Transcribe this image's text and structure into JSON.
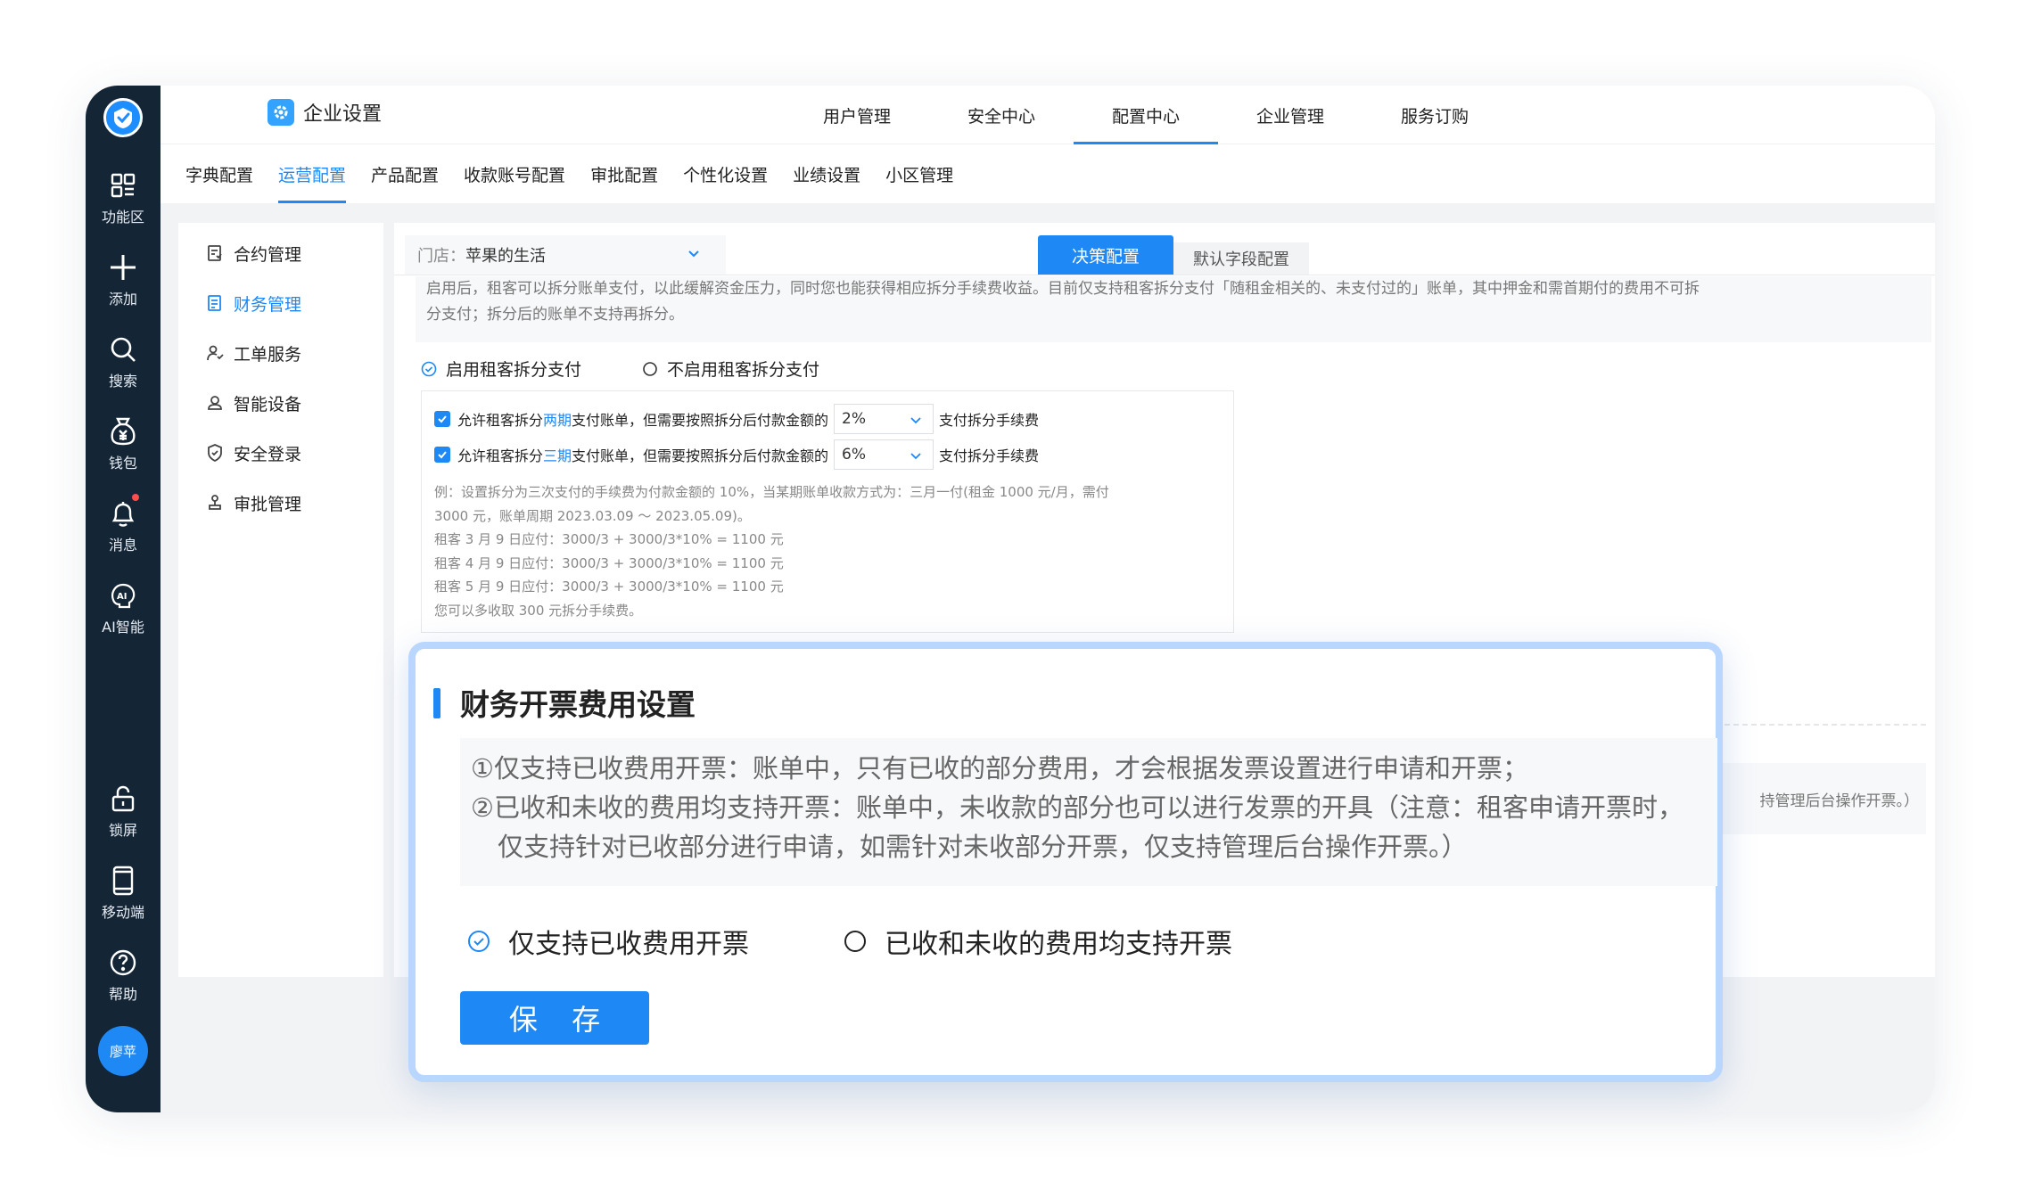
{
  "rail": {
    "items": [
      {
        "label": "功能区",
        "icon": "grid-icon"
      },
      {
        "label": "添加",
        "icon": "plus-icon"
      },
      {
        "label": "搜索",
        "icon": "search-icon"
      },
      {
        "label": "钱包",
        "icon": "wallet-icon"
      },
      {
        "label": "消息",
        "icon": "bell-icon"
      },
      {
        "label": "AI智能",
        "icon": "ai-icon"
      },
      {
        "label": "锁屏",
        "icon": "lock-icon"
      },
      {
        "label": "移动端",
        "icon": "mobile-icon"
      },
      {
        "label": "帮助",
        "icon": "help-icon"
      }
    ],
    "avatar": "廖苹"
  },
  "header": {
    "title": "企业设置",
    "tabs": [
      "用户管理",
      "安全中心",
      "配置中心",
      "企业管理",
      "服务订购"
    ],
    "active_tab": "配置中心"
  },
  "subnav": {
    "tabs": [
      "字典配置",
      "运营配置",
      "产品配置",
      "收款账号配置",
      "审批配置",
      "个性化设置",
      "业绩设置",
      "小区管理"
    ],
    "active": "运营配置"
  },
  "leftmenu": {
    "items": [
      {
        "label": "合约管理",
        "icon": "contract-icon"
      },
      {
        "label": "财务管理",
        "icon": "finance-icon"
      },
      {
        "label": "工单服务",
        "icon": "service-icon"
      },
      {
        "label": "智能设备",
        "icon": "device-icon"
      },
      {
        "label": "安全登录",
        "icon": "shield-icon"
      },
      {
        "label": "审批管理",
        "icon": "approval-icon"
      }
    ],
    "active": "财务管理"
  },
  "main": {
    "store_prefix": "门店：",
    "store_value": "苹果的生活",
    "btn_decision": "决策配置",
    "btn_default": "默认字段配置",
    "desc_line1": "启用后，租客可以拆分账单支付，以此缓解资金压力，同时您也能获得相应拆分手续费收益。目前仅支持租客拆分支付「随租金相关的、未支付过的」账单，其中押金和需首期付的费用不可拆",
    "desc_line2": "分支付；拆分后的账单不支持再拆分。",
    "radio_enable": "启用租客拆分支付",
    "radio_disable": "不启用租客拆分支付",
    "row1": {
      "pre": "允许租客拆分",
      "hl": "两期",
      "post": "支付账单，但需要按照拆分后付款金额的",
      "value": "2%",
      "suffix": "支付拆分手续费"
    },
    "row2": {
      "pre": "允许租客拆分",
      "hl": "三期",
      "post": "支付账单，但需要按照拆分后付款金额的",
      "value": "6%",
      "suffix": "支付拆分手续费"
    },
    "example": [
      "例：设置拆分为三次支付的手续费为付款金额的 10%，当某期账单收款方式为：三月一付(租金 1000 元/月，需付",
      "3000 元，账单周期 2023.03.09 ～ 2023.05.09)。",
      "租客 3 月 9 日应付：3000/3 + 3000/3*10% = 1100 元",
      "租客 4 月 9 日应付：3000/3 + 3000/3*10% = 1100 元",
      "租客 5 月 9 日应付：3000/3 + 3000/3*10% = 1100 元",
      "您可以多收取 300 元拆分手续费。"
    ],
    "right_fragment": "持管理后台操作开票。）"
  },
  "popup": {
    "title": "财务开票费用设置",
    "desc_line1": "①仅支持已收费用开票：账单中，只有已收的部分费用，才会根据发票设置进行申请和开票；",
    "desc_line2": "②已收和未收的费用均支持开票：账单中，未收款的部分也可以进行发票的开具（注意：租客申请开票时，",
    "desc_line3": "仅支持针对已收部分进行申请，如需针对未收部分开票，仅支持管理后台操作开票。）",
    "option1": "仅支持已收费用开票",
    "option2": "已收和未收的费用均支持开票",
    "save": "保 存"
  },
  "colors": {
    "accent": "#1e88f5",
    "rail": "#142536",
    "popup_border": "#b9d6ff"
  }
}
